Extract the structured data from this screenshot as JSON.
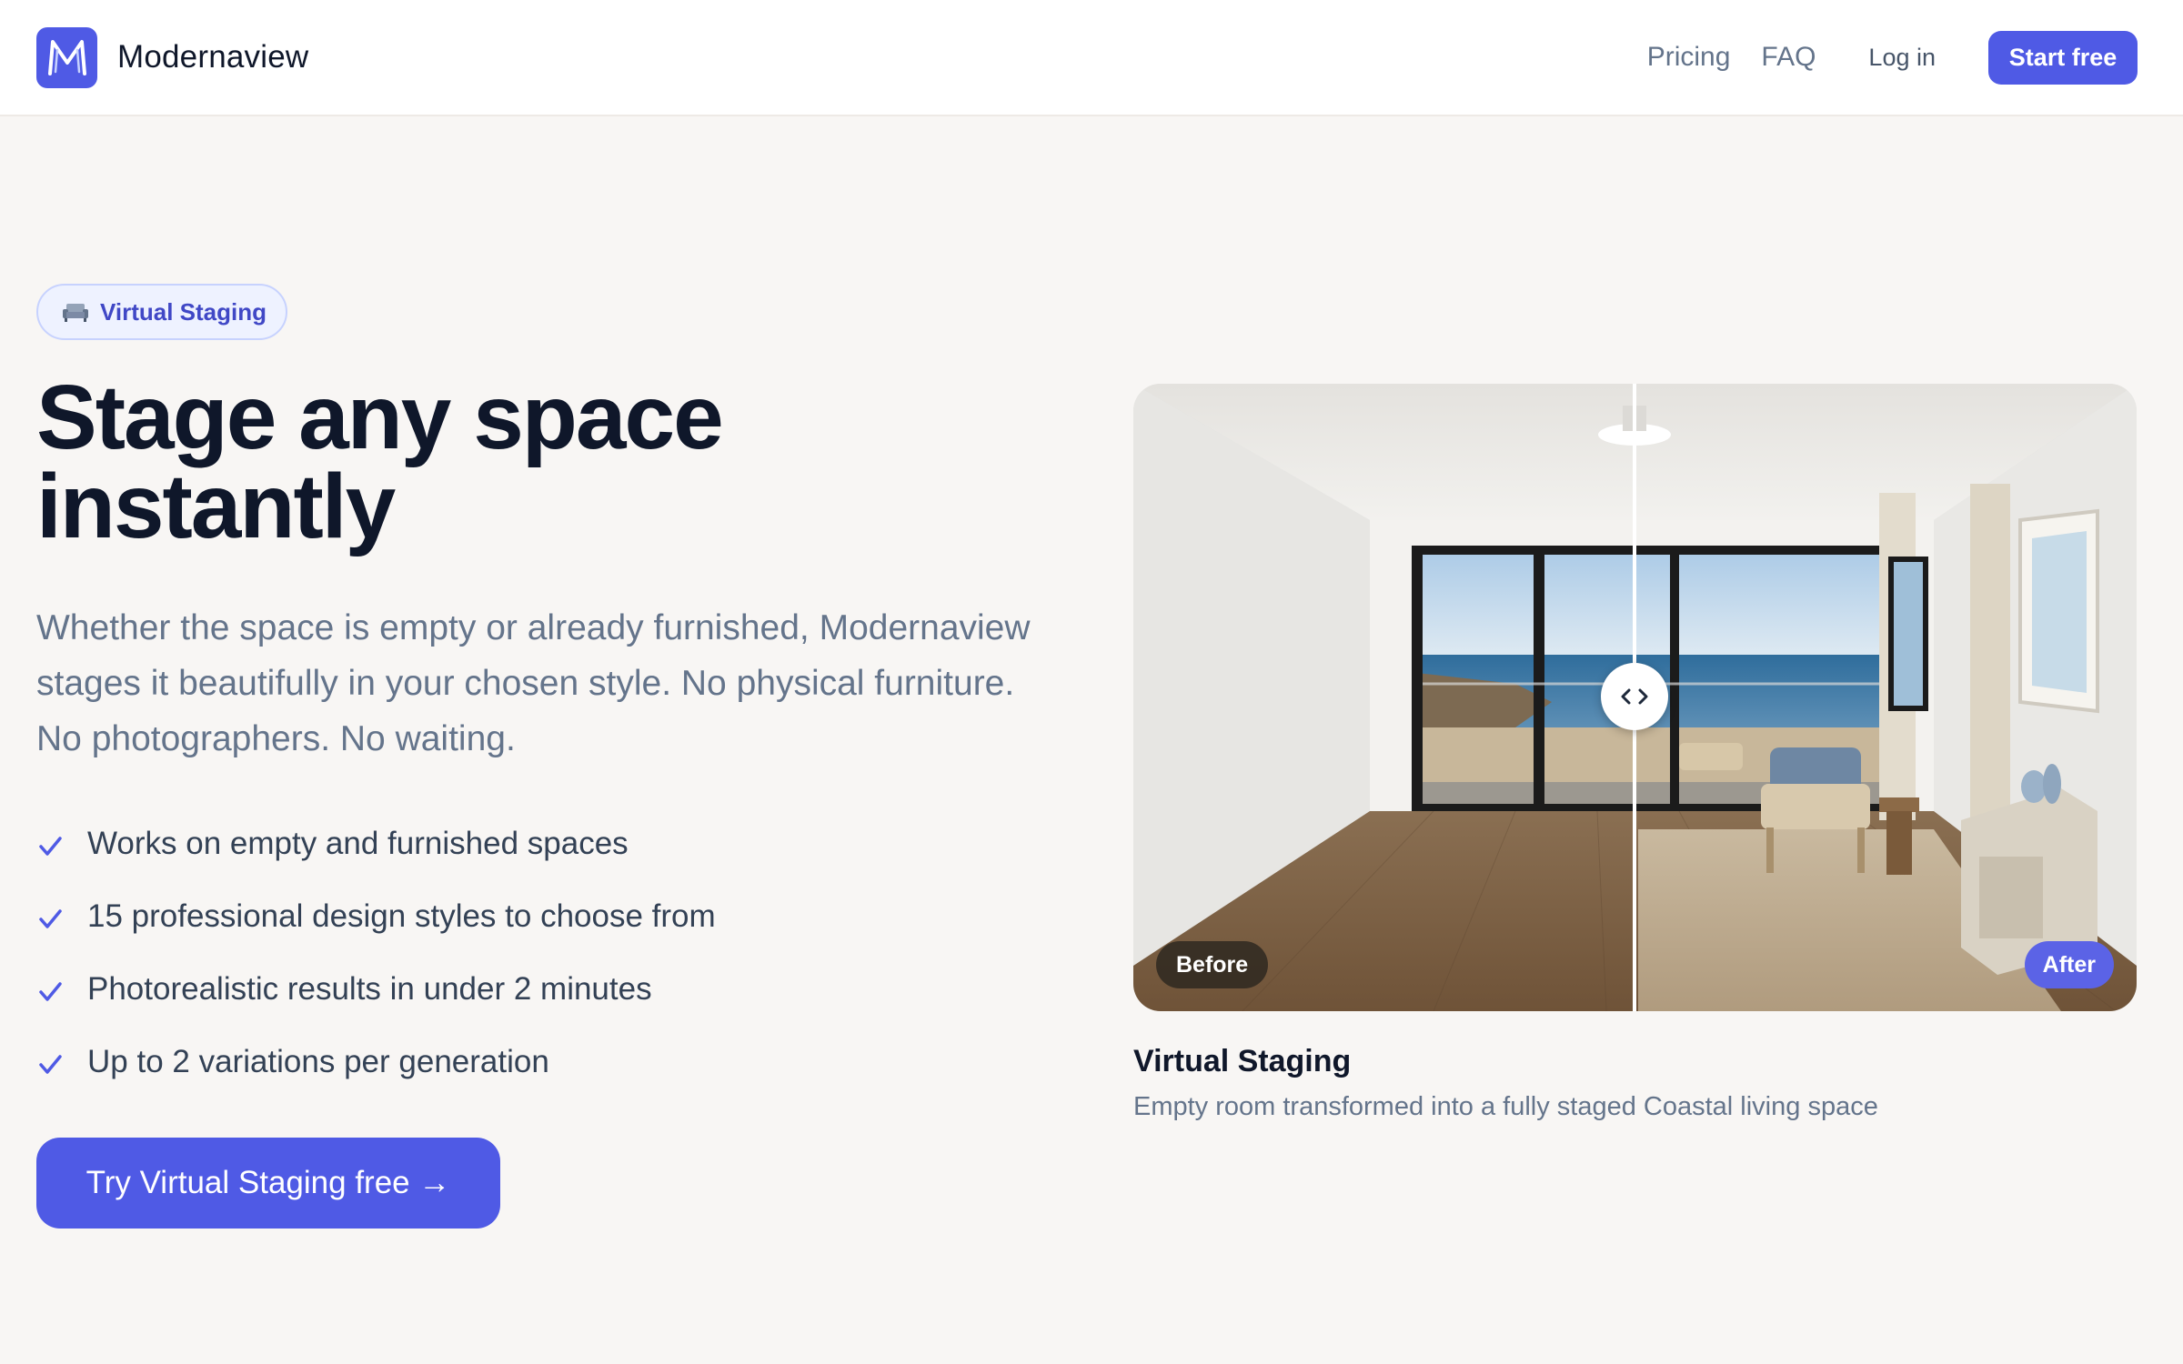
{
  "brand": {
    "name": "Modernaview",
    "logo_icon": "m-logo-icon"
  },
  "nav": {
    "pricing": "Pricing",
    "faq": "FAQ",
    "login": "Log in",
    "start": "Start free"
  },
  "hero": {
    "badge": "Virtual Staging",
    "badge_icon": "sofa-icon",
    "title": "Stage any space instantly",
    "subtitle": "Whether the space is empty or already furnished, Modernaview stages it beautifully in your chosen style. No physical furniture. No photographers. No waiting.",
    "features": [
      "Works on empty and furnished spaces",
      "15 professional design styles to choose from",
      "Photorealistic results in under 2 minutes",
      "Up to 2 variations per generation"
    ],
    "cta": "Try Virtual Staging free →"
  },
  "compare": {
    "before_label": "Before",
    "after_label": "After",
    "slider_position": 0.5,
    "caption_title": "Virtual Staging",
    "caption_sub": "Empty room transformed into a fully staged Coastal living space"
  },
  "colors": {
    "accent": "#4f5ae5",
    "background": "#f8f6f4",
    "heading": "#0f172a",
    "muted": "#64748b"
  }
}
